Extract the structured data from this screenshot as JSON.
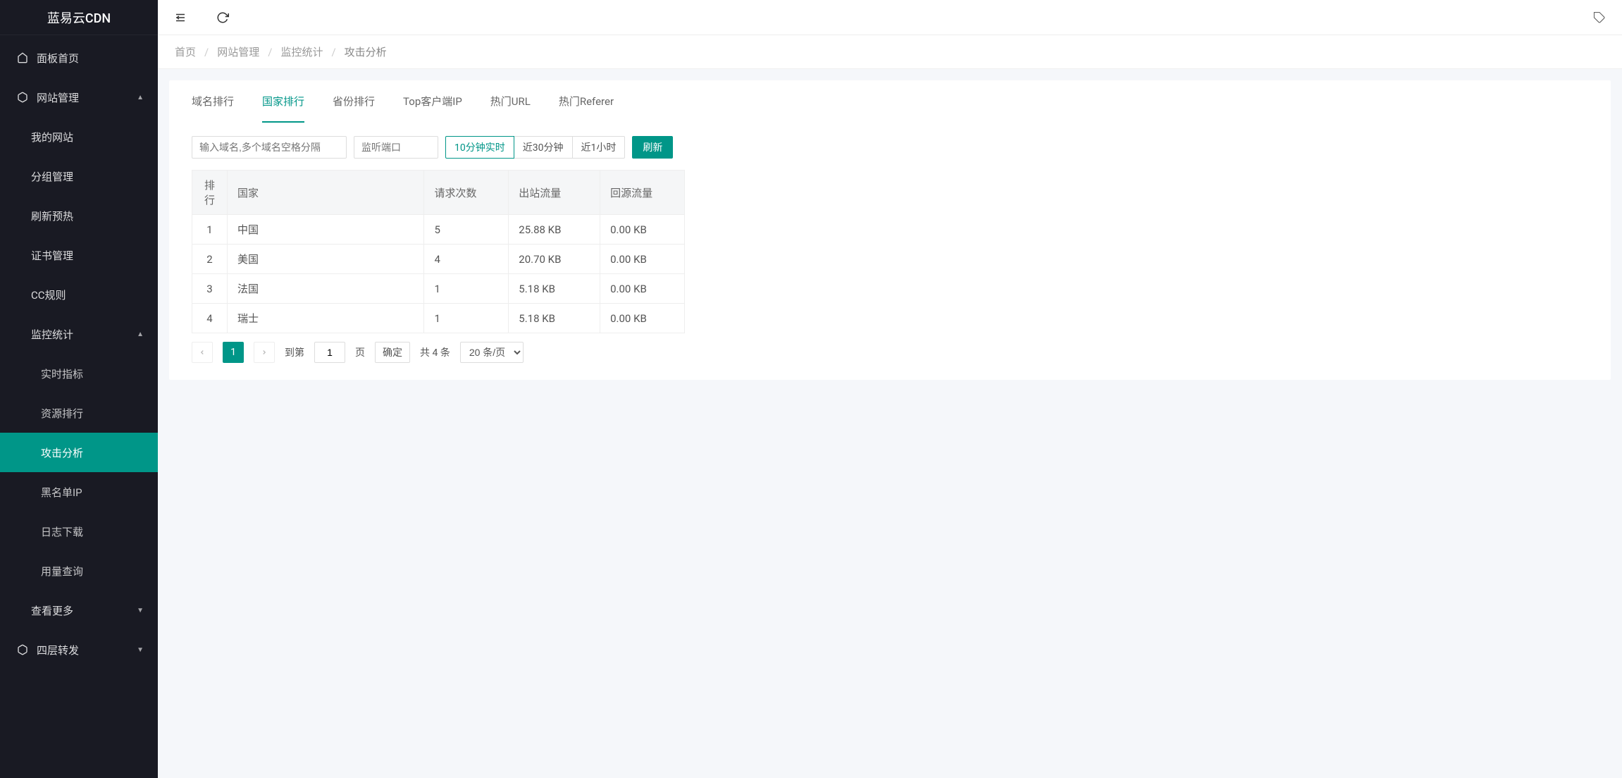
{
  "logo": "蓝易云CDN",
  "sidebar": {
    "home": "面板首页",
    "site_mgmt": "网站管理",
    "site_sub": {
      "my_site": "我的网站",
      "group_mgmt": "分组管理",
      "refresh_preheat": "刷新预热",
      "cert_mgmt": "证书管理",
      "cc_rule": "CC规则"
    },
    "monitor": "监控统计",
    "monitor_sub": {
      "realtime": "实时指标",
      "resource_rank": "资源排行",
      "attack_analysis": "攻击分析",
      "blacklist_ip": "黑名单IP",
      "log_download": "日志下载",
      "usage_query": "用量查询"
    },
    "view_more": "查看更多",
    "l4_forward": "四层转发"
  },
  "breadcrumb": {
    "home": "首页",
    "site_mgmt": "网站管理",
    "monitor": "监控统计",
    "current": "攻击分析"
  },
  "tabs": {
    "domain_rank": "域名排行",
    "country_rank": "国家排行",
    "province_rank": "省份排行",
    "top_client_ip": "Top客户端IP",
    "hot_url": "热门URL",
    "hot_referer": "热门Referer"
  },
  "filters": {
    "domain_placeholder": "输入域名,多个域名空格分隔",
    "port_placeholder": "监听端口",
    "seg_10min": "10分钟实时",
    "seg_30min": "近30分钟",
    "seg_1h": "近1小时",
    "refresh_btn": "刷新"
  },
  "table": {
    "headers": {
      "rank": "排行",
      "country": "国家",
      "req_count": "请求次数",
      "out_traffic": "出站流量",
      "origin_traffic": "回源流量"
    },
    "rows": [
      {
        "rank": "1",
        "country": "中国",
        "req": "5",
        "out": "25.88 KB",
        "origin": "0.00 KB"
      },
      {
        "rank": "2",
        "country": "美国",
        "req": "4",
        "out": "20.70 KB",
        "origin": "0.00 KB"
      },
      {
        "rank": "3",
        "country": "法国",
        "req": "1",
        "out": "5.18 KB",
        "origin": "0.00 KB"
      },
      {
        "rank": "4",
        "country": "瑞士",
        "req": "1",
        "out": "5.18 KB",
        "origin": "0.00 KB"
      }
    ]
  },
  "pagination": {
    "current": "1",
    "goto_label": "到第",
    "goto_value": "1",
    "page_label": "页",
    "confirm": "确定",
    "total": "共 4 条",
    "per_page": "20 条/页"
  }
}
